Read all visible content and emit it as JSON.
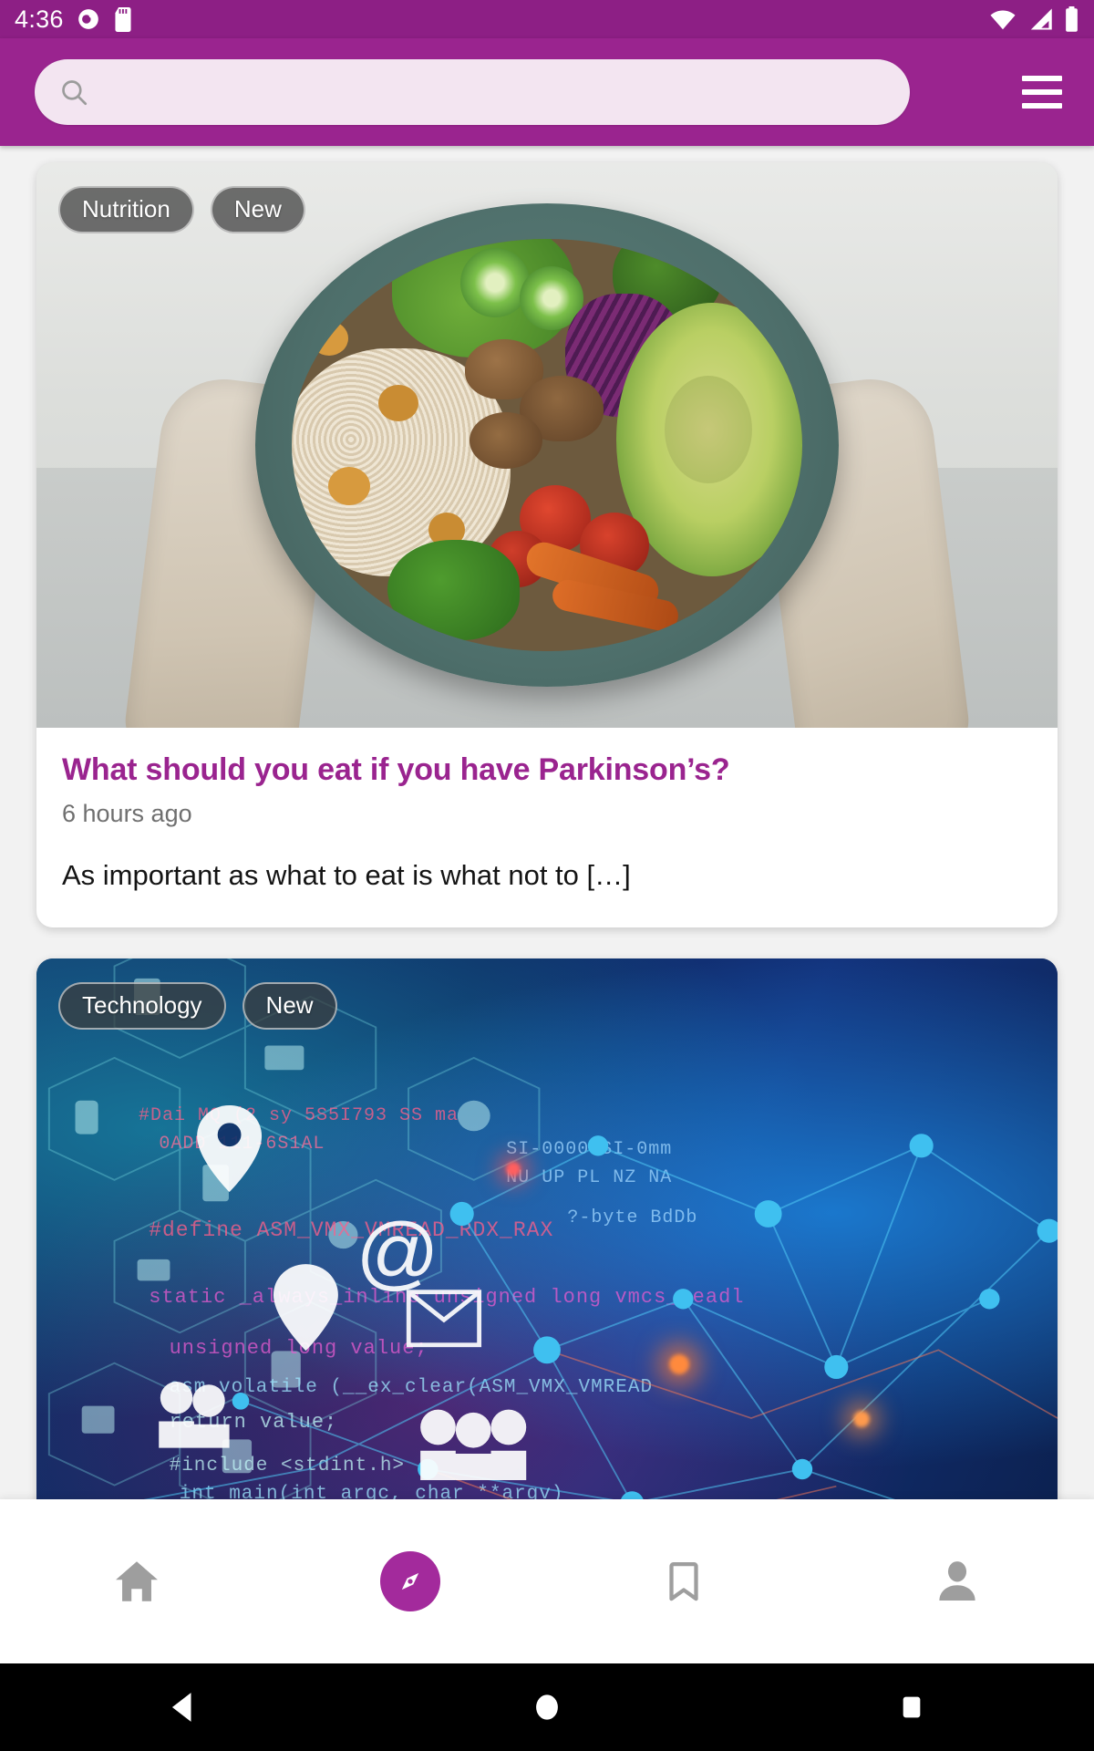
{
  "status_bar": {
    "time": "4:36",
    "icons": [
      "alarm-icon",
      "sd-card-icon",
      "wifi-icon",
      "cellular-signal-icon",
      "battery-icon"
    ]
  },
  "app_bar": {
    "search": {
      "value": "",
      "placeholder": ""
    },
    "search_icon": "search-icon",
    "menu_icon": "hamburger-menu-icon",
    "color": "#9a248f"
  },
  "feed": {
    "articles": [
      {
        "chips": [
          "Nutrition",
          "New"
        ],
        "image": "buddha-bowl-photo",
        "title": "What should you eat if you have Parkinson’s?",
        "time": "6 hours ago",
        "excerpt": "As important as what to eat is what not to […]"
      },
      {
        "chips": [
          "Technology",
          "New"
        ],
        "image": "technology-network-photo",
        "title": "",
        "time": "",
        "excerpt": ""
      }
    ]
  },
  "bottom_nav": {
    "items": [
      {
        "name": "home",
        "icon": "home-icon",
        "active": false
      },
      {
        "name": "explore",
        "icon": "compass-icon",
        "active": true
      },
      {
        "name": "bookmarks",
        "icon": "bookmark-icon",
        "active": false
      },
      {
        "name": "profile",
        "icon": "person-icon",
        "active": false
      }
    ],
    "active_color": "#a32a9c",
    "inactive_color": "#9e9e9e"
  },
  "system_nav": {
    "items": [
      {
        "name": "back",
        "icon": "triangle-back-icon"
      },
      {
        "name": "home",
        "icon": "circle-home-icon"
      },
      {
        "name": "recents",
        "icon": "square-recents-icon"
      }
    ]
  },
  "theme": {
    "accent": "#9a248f",
    "status_bar_bg": "#8d1f85",
    "page_bg": "#f2f2f2",
    "card_bg": "#ffffff",
    "title_color": "#9a248f",
    "meta_color": "#6f6f6f",
    "body_color": "#141414"
  }
}
